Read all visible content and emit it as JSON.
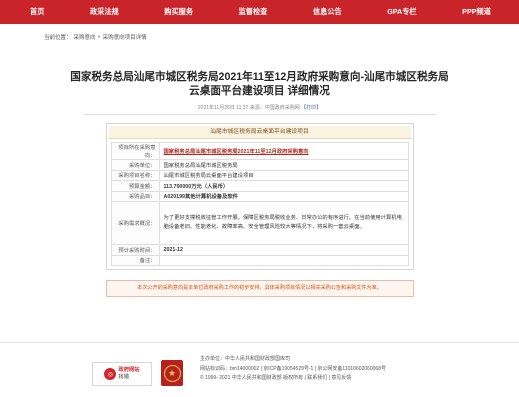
{
  "nav": {
    "items": [
      "首页",
      "政采法规",
      "购买服务",
      "监督检查",
      "信息公告",
      "GPA专栏",
      "PPP频道"
    ]
  },
  "breadcrumb": {
    "prefix": "当前位置：",
    "link": "采购意向",
    "sep": "»",
    "current": "采购意向项目详情"
  },
  "page": {
    "title_line1": "国家税务总局汕尾市城区税务局2021年11至12月政府采购意向-汕尾市城区税务局",
    "title_line2": "云桌面平台建设项目 详细情况",
    "meta_date": "2021年11月26日 11:37",
    "meta_source": "来源：中国政府采购网",
    "meta_print": "【打印】"
  },
  "detail": {
    "header": "汕尾市城区税务局云桌面平台建设项目",
    "rows": [
      {
        "key": "项目所在采购意向：",
        "value": "国家税务总局汕尾市城区税务局2021年11至12月政府采购意向",
        "type": "link"
      },
      {
        "key": "采购单位：",
        "value": "国家税务总局汕尾市城区税务局",
        "type": "text"
      },
      {
        "key": "采购项目名称：",
        "value": "汕尾市城区税务局云桌面平台建设项目",
        "type": "text"
      },
      {
        "key": "预算金额：",
        "value": "113.700000万元（人民币）",
        "type": "bold"
      },
      {
        "key": "采购品目：",
        "value": "A020199其他计算机设备及软件",
        "type": "bold"
      },
      {
        "key": "采购需求概况：",
        "value": "为了更好支撑税收征管工作开展，保障区税务局税收业务、日常办公的有序进行。在当前使用计算机电脑设备老旧、性能老化、故障率高、安全管理风险较大等情况下，将采购一套云桌面。",
        "type": "tall"
      },
      {
        "key": "预计采购时间：",
        "value": "2021-12",
        "type": "bold"
      },
      {
        "key": "备注：",
        "value": "",
        "type": "text"
      }
    ]
  },
  "notice": "本次公开的采购意向是本单位政府采购工作的初步安排，具体采购项目情况以相关采购公告和采购文件为准。",
  "footer": {
    "badge_title": "政府网站",
    "badge_sub": "找错",
    "emblem_char": "★",
    "sponsor": "主办单位：中华人民共和国财政部国库司",
    "icp": "网站标识码：bm14000002",
    "beian1": "京ICP备19054529号-1",
    "beian2": "京公网安备11010602060068号",
    "copyright": "© 1999- 2021 中华人民共和国财政部 版权所有",
    "link_contact": "联系我们",
    "link_feedback": "意见反馈",
    "sep": "|"
  },
  "colors": {
    "nav_bg": "#c8242a",
    "link_red": "#b32a1f",
    "notice_text": "#d1531e",
    "box_head_bg": "#fbf3e1"
  }
}
